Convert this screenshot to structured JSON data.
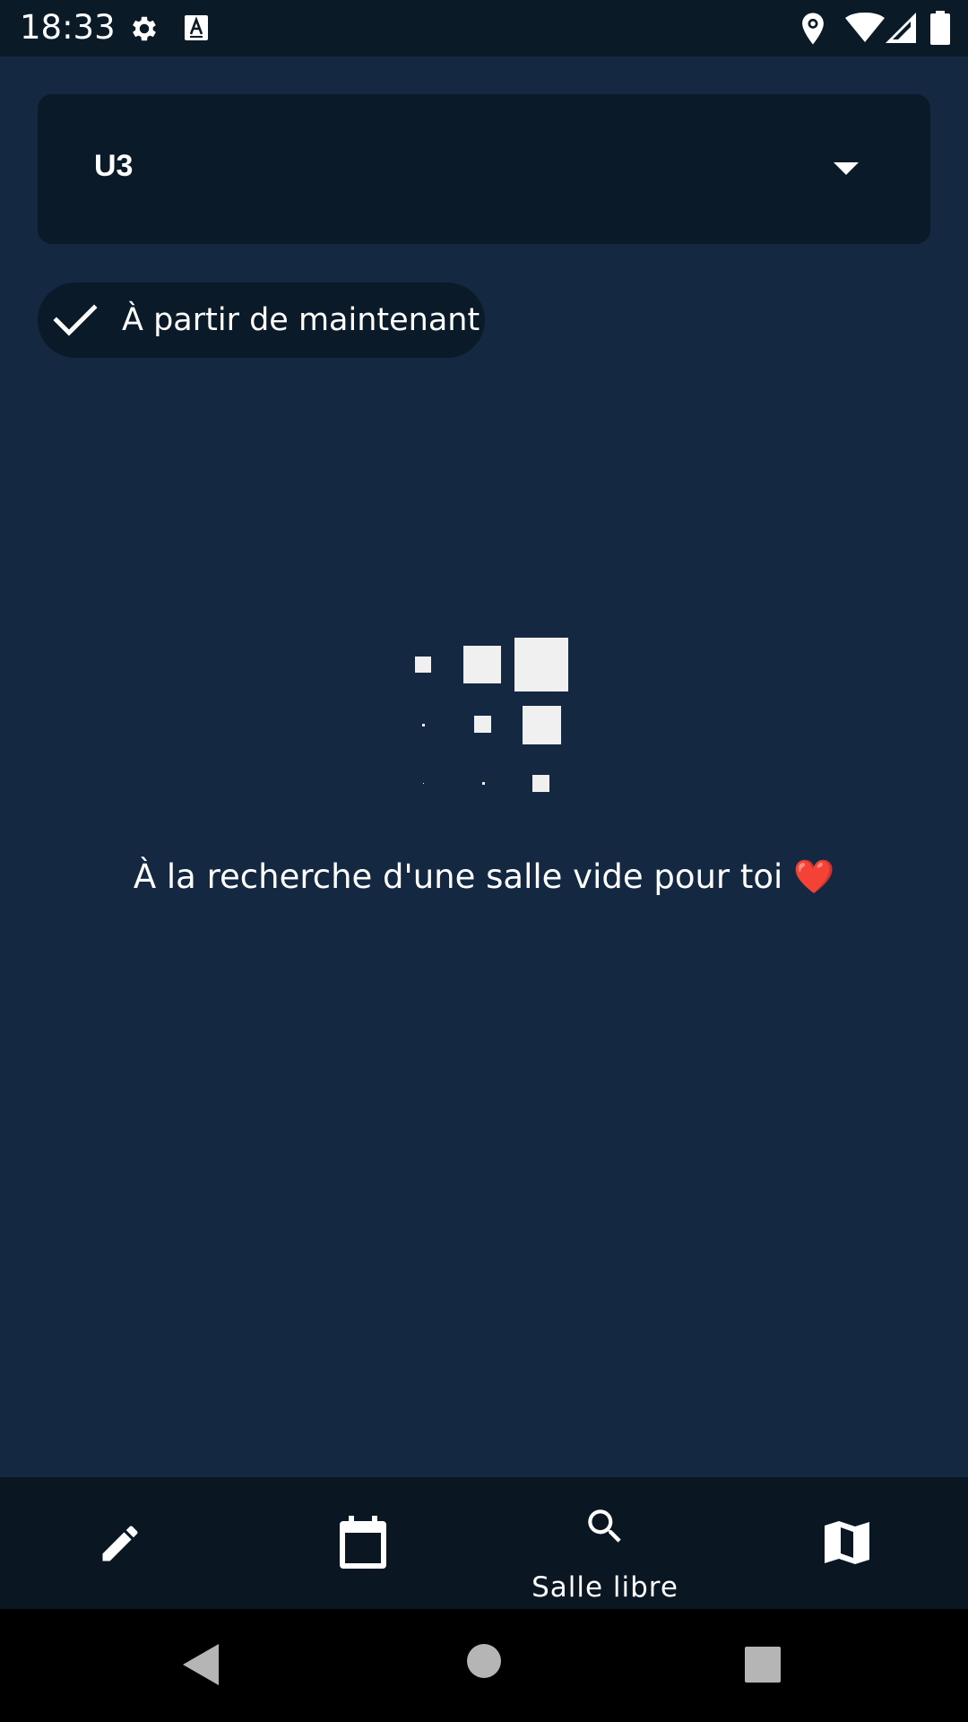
{
  "status_bar": {
    "time": "18:33",
    "icons": [
      "gear-icon",
      "text-a-icon",
      "location-icon",
      "wifi-icon",
      "signal-icon",
      "battery-icon"
    ]
  },
  "dropdown": {
    "selected_value": "U3",
    "icon": "triangle-down-icon"
  },
  "filter_chip": {
    "label": "À partir de maintenant",
    "selected": true,
    "icon": "check-icon"
  },
  "loading": {
    "message": "À la recherche d'une salle vide pour toi",
    "emoji": "❤️"
  },
  "bottom_nav": {
    "items": [
      {
        "icon": "pencil-icon",
        "label": ""
      },
      {
        "icon": "calendar-icon",
        "label": ""
      },
      {
        "icon": "search-icon",
        "label": "Salle libre",
        "active": true
      },
      {
        "icon": "map-icon",
        "label": ""
      }
    ]
  },
  "system_nav": {
    "buttons": [
      "back-icon",
      "home-icon",
      "recents-icon"
    ]
  },
  "colors": {
    "background": "#142941",
    "surface": "#0b1a28",
    "text": "#ffffff",
    "accent_heart": "#e0242b"
  }
}
